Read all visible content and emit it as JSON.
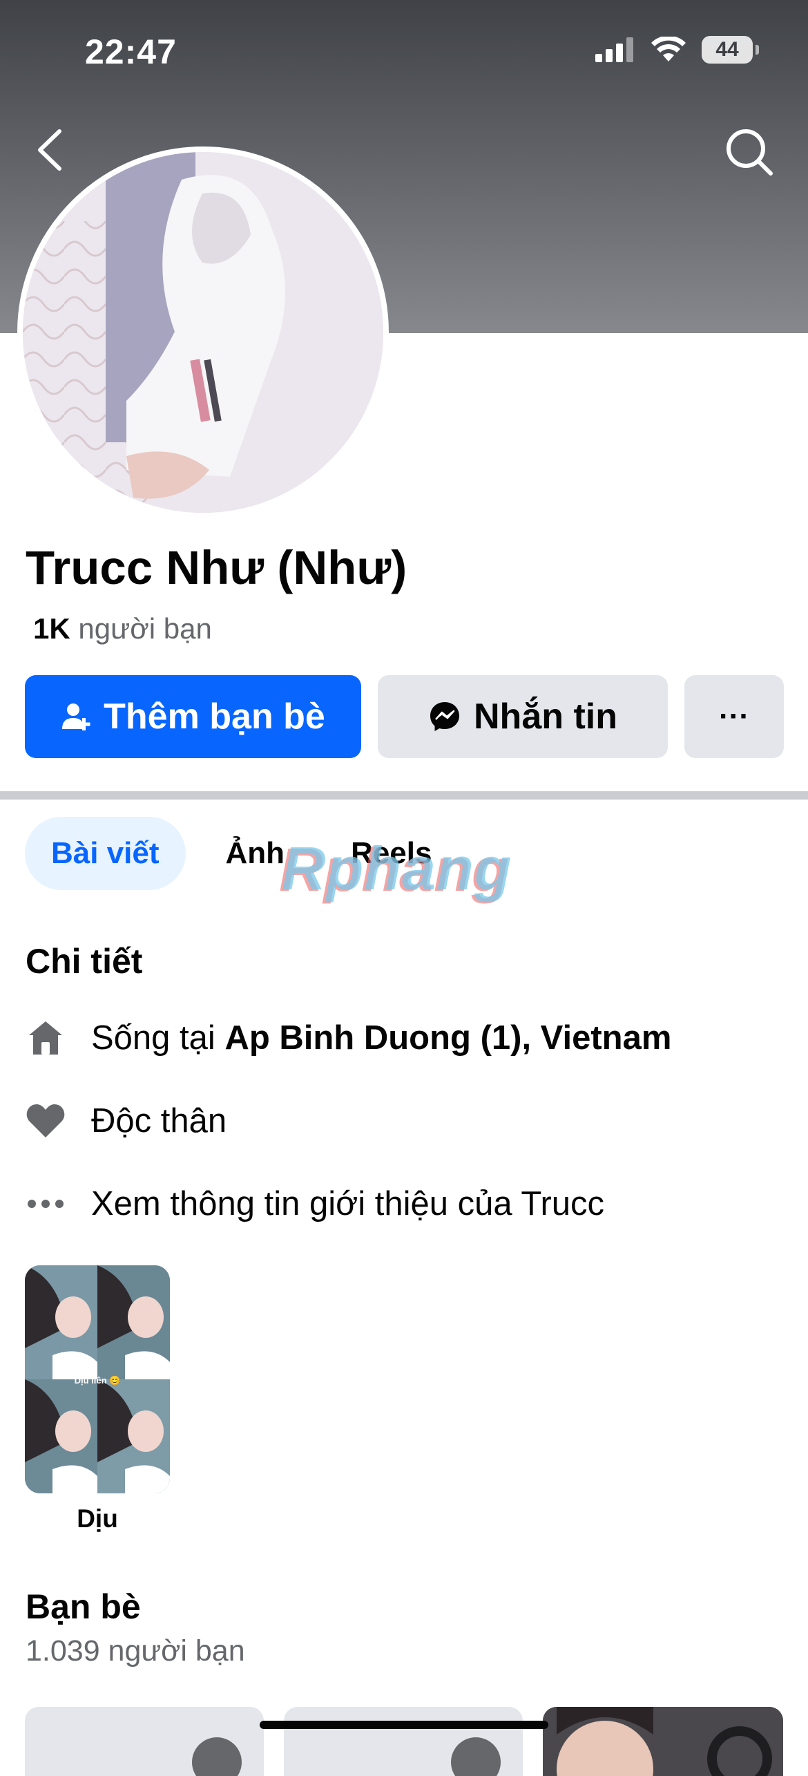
{
  "status_bar": {
    "time": "22:47",
    "battery": "44"
  },
  "profile": {
    "name": "Trucc Như (Như)",
    "friends_count_bold": "1K",
    "friends_count_label": "người bạn"
  },
  "actions": {
    "add_friend": "Thêm bạn bè",
    "message": "Nhắn tin",
    "more": "···"
  },
  "tabs": [
    {
      "label": "Bài viết",
      "active": true
    },
    {
      "label": "Ảnh",
      "active": false
    },
    {
      "label": "Reels",
      "active": false
    }
  ],
  "watermark": "Rphang",
  "details": {
    "title": "Chi tiết",
    "lives_in_prefix": "Sống tại",
    "lives_in_value": "Ap Binh Duong (1), Vietnam",
    "relationship": "Độc thân",
    "see_about": "Xem thông tin giới thiệu của Trucc"
  },
  "highlight": {
    "label": "Dịu",
    "thumb_caption": "Dịu liên 😊"
  },
  "friends": {
    "title": "Bạn bè",
    "count": "1.039 người bạn"
  },
  "colors": {
    "primary": "#0866ff",
    "secondary_button": "#e4e6eb",
    "muted_text": "#65676b",
    "active_tab_bg": "#e7f3ff"
  }
}
